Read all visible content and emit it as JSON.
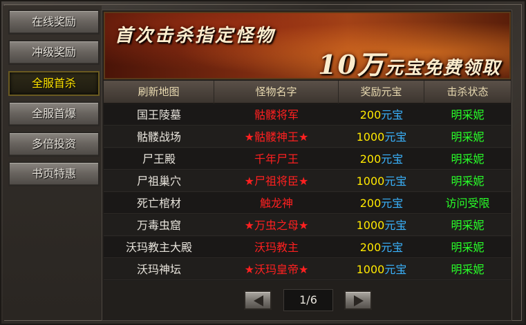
{
  "sidebar": {
    "items": [
      {
        "label": "在线奖励",
        "active": false
      },
      {
        "label": "冲级奖励",
        "active": false
      },
      {
        "label": "全服首杀",
        "active": true
      },
      {
        "label": "全服首爆",
        "active": false
      },
      {
        "label": "多倍投资",
        "active": false
      },
      {
        "label": "书页特惠",
        "active": false
      }
    ]
  },
  "banner": {
    "title": "首次击杀指定怪物",
    "sub_big": "10万",
    "sub_rest": "元宝免费领取"
  },
  "table": {
    "headers": [
      "刷新地图",
      "怪物名字",
      "奖励元宝",
      "击杀状态"
    ],
    "rows": [
      {
        "map": "国王陵墓",
        "monster": "骷髅将军",
        "reward": "200",
        "unit": "元宝",
        "status": "明采妮"
      },
      {
        "map": "骷髅战场",
        "monster": "★骷髅神王★",
        "reward": "1000",
        "unit": "元宝",
        "status": "明采妮"
      },
      {
        "map": "尸王殿",
        "monster": "千年尸王",
        "reward": "200",
        "unit": "元宝",
        "status": "明采妮"
      },
      {
        "map": "尸祖巢穴",
        "monster": "★尸祖将臣★",
        "reward": "1000",
        "unit": "元宝",
        "status": "明采妮"
      },
      {
        "map": "死亡棺材",
        "monster": "触龙神",
        "reward": "200",
        "unit": "元宝",
        "status": "访问受限"
      },
      {
        "map": "万毒虫窟",
        "monster": "★万虫之母★",
        "reward": "1000",
        "unit": "元宝",
        "status": "明采妮"
      },
      {
        "map": "沃玛教主大殿",
        "monster": "沃玛教主",
        "reward": "200",
        "unit": "元宝",
        "status": "明采妮"
      },
      {
        "map": "沃玛神坛",
        "monster": "★沃玛皇帝★",
        "reward": "1000",
        "unit": "元宝",
        "status": "明采妮"
      }
    ]
  },
  "pager": {
    "indicator": "1/6"
  },
  "colors": {
    "active_tab": "#ffe400",
    "monster": "#ff2020",
    "reward_number": "#ffe800",
    "reward_unit": "#3ab4ff",
    "status": "#28ff28"
  },
  "icons": {
    "prev": "arrow-left-icon",
    "next": "arrow-right-icon"
  }
}
